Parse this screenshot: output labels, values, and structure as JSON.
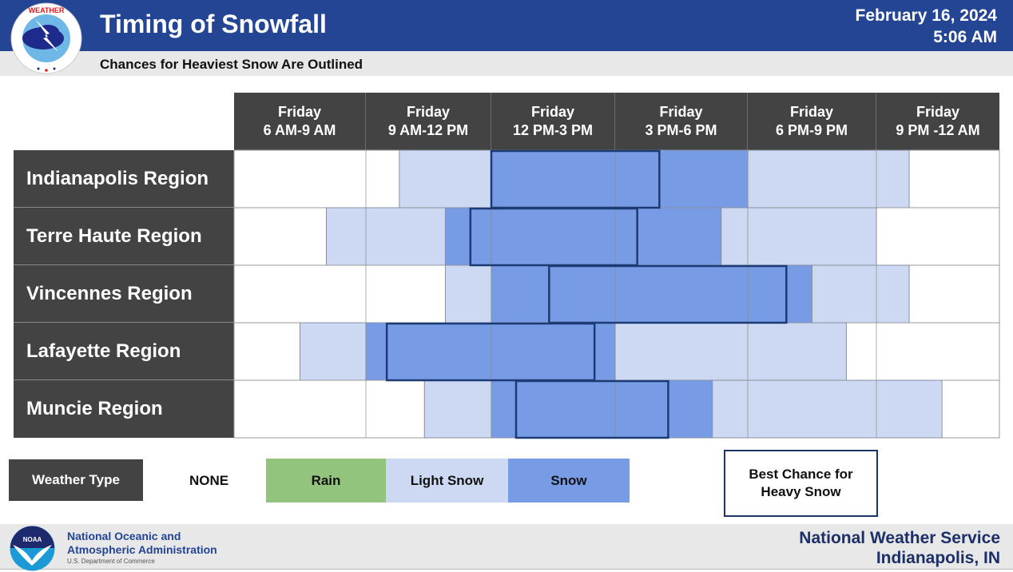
{
  "header": {
    "title": "Timing of Snowfall",
    "subtitle": "Chances for Heaviest Snow Are Outlined",
    "date": "February 16, 2024",
    "time": "5:06 AM"
  },
  "colors": {
    "header_blue": "#234594",
    "none": "#ffffff",
    "rain": "#93c47d",
    "light_snow": "#cdd9f3",
    "snow": "#779be5",
    "outline": "#1c3a73",
    "label_bg": "#434343"
  },
  "chart_data": {
    "type": "table",
    "title": "Timing of Snowfall",
    "subtitle": "Chances for Heaviest Snow Are Outlined",
    "time_unit": "hours after Friday 6 AM",
    "time_range": [
      0,
      18
    ],
    "columns": [
      {
        "day": "Friday",
        "period": "6 AM-9 AM"
      },
      {
        "day": "Friday",
        "period": "9 AM-12 PM"
      },
      {
        "day": "Friday",
        "period": "12 PM-3 PM"
      },
      {
        "day": "Friday",
        "period": "3 PM-6 PM"
      },
      {
        "day": "Friday",
        "period": "6 PM-9 PM"
      },
      {
        "day": "Friday",
        "period": "9 PM -12 AM"
      }
    ],
    "rows": [
      {
        "region": "Indianapolis Region",
        "segments": [
          {
            "type": "light_snow",
            "start": 3.8,
            "end": 6
          },
          {
            "type": "snow",
            "start": 6,
            "end": 12
          },
          {
            "type": "light_snow",
            "start": 12,
            "end": 15.8
          }
        ],
        "heavy_snow": {
          "start": 6,
          "end": 10
        }
      },
      {
        "region": "Terre Haute Region",
        "segments": [
          {
            "type": "light_snow",
            "start": 2.1,
            "end": 4.9
          },
          {
            "type": "snow",
            "start": 4.9,
            "end": 11.4
          },
          {
            "type": "light_snow",
            "start": 11.4,
            "end": 15
          }
        ],
        "heavy_snow": {
          "start": 5.5,
          "end": 9.5
        }
      },
      {
        "region": "Vincennes Region",
        "segments": [
          {
            "type": "light_snow",
            "start": 4.9,
            "end": 6
          },
          {
            "type": "snow",
            "start": 6,
            "end": 13.5
          },
          {
            "type": "light_snow",
            "start": 13.5,
            "end": 15.8
          }
        ],
        "heavy_snow": {
          "start": 7.4,
          "end": 12.9
        }
      },
      {
        "region": "Lafayette Region",
        "segments": [
          {
            "type": "light_snow",
            "start": 1.5,
            "end": 3
          },
          {
            "type": "snow",
            "start": 3,
            "end": 9
          },
          {
            "type": "light_snow",
            "start": 9,
            "end": 14.3
          }
        ],
        "heavy_snow": {
          "start": 3.5,
          "end": 8.5
        }
      },
      {
        "region": "Muncie Region",
        "segments": [
          {
            "type": "light_snow",
            "start": 4.4,
            "end": 6
          },
          {
            "type": "snow",
            "start": 6,
            "end": 11.2
          },
          {
            "type": "light_snow",
            "start": 11.2,
            "end": 16.6
          }
        ],
        "heavy_snow": {
          "start": 6.6,
          "end": 10.2
        }
      }
    ],
    "legend": {
      "title": "Weather Type",
      "items": [
        {
          "key": "none",
          "label": "NONE"
        },
        {
          "key": "rain",
          "label": "Rain"
        },
        {
          "key": "light_snow",
          "label": "Light Snow"
        },
        {
          "key": "snow",
          "label": "Snow"
        }
      ],
      "outline_label": "Best Chance for Heavy Snow"
    }
  },
  "footer": {
    "noaa_line1": "National Oceanic and",
    "noaa_line2": "Atmospheric Administration",
    "noaa_dept": "U.S. Department of Commerce",
    "nws_line1": "National Weather Service",
    "nws_line2": "Indianapolis, IN",
    "noaa_logo_text": "NOAA"
  }
}
